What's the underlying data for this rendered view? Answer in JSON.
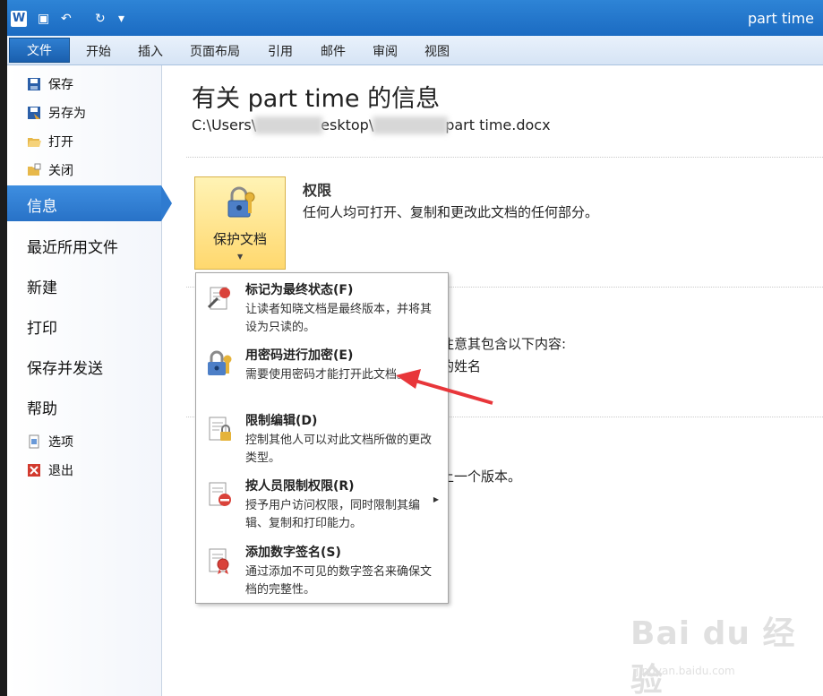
{
  "window": {
    "title": "part time",
    "app_icon_letter": "W"
  },
  "qat": {
    "save_glyph": "▣",
    "undo_glyph": "↶",
    "redo_glyph": "↻",
    "more_glyph": "▾"
  },
  "tabs": {
    "file": "文件",
    "items": [
      "开始",
      "插入",
      "页面布局",
      "引用",
      "邮件",
      "审阅",
      "视图"
    ]
  },
  "nav": {
    "save": "保存",
    "save_as": "另存为",
    "open": "打开",
    "close": "关闭",
    "info": "信息",
    "recent": "最近所用文件",
    "new": "新建",
    "print": "打印",
    "save_send": "保存并发送",
    "help": "帮助",
    "options": "选项",
    "exit": "退出"
  },
  "main": {
    "title": "有关 part time 的信息",
    "path_part1": "C:\\Users\\",
    "path_part2": "esktop\\",
    "path_part3": "part time.docx",
    "protect_button": "保护文档",
    "permission_heading": "权限",
    "permission_desc": "任何人均可打开、复制和更改此文档的任何部分。",
    "frag1": "注意其包含以下内容:",
    "frag2": "的姓名",
    "frag3": "上一个版本。"
  },
  "menu": [
    {
      "title": "标记为最终状态(F)",
      "desc": "让读者知晓文档是最终版本，并将其设为只读的。"
    },
    {
      "title": "用密码进行加密(E)",
      "desc": "需要使用密码才能打开此文档。"
    },
    {
      "title": "限制编辑(D)",
      "desc": "控制其他人可以对此文档所做的更改类型。"
    },
    {
      "title": "按人员限制权限(R)",
      "desc": "授予用户访问权限，同时限制其编辑、复制和打印能力。"
    },
    {
      "title": "添加数字签名(S)",
      "desc": "通过添加不可见的数字签名来确保文档的完整性。"
    }
  ],
  "watermark": {
    "logo": "Bai du 经验",
    "url": "jingyan.baidu.com"
  },
  "colors": {
    "accent": "#2872c7",
    "ribbon": "#1b6bc2",
    "button": "#ffd86e",
    "arrow": "#e8363a"
  }
}
